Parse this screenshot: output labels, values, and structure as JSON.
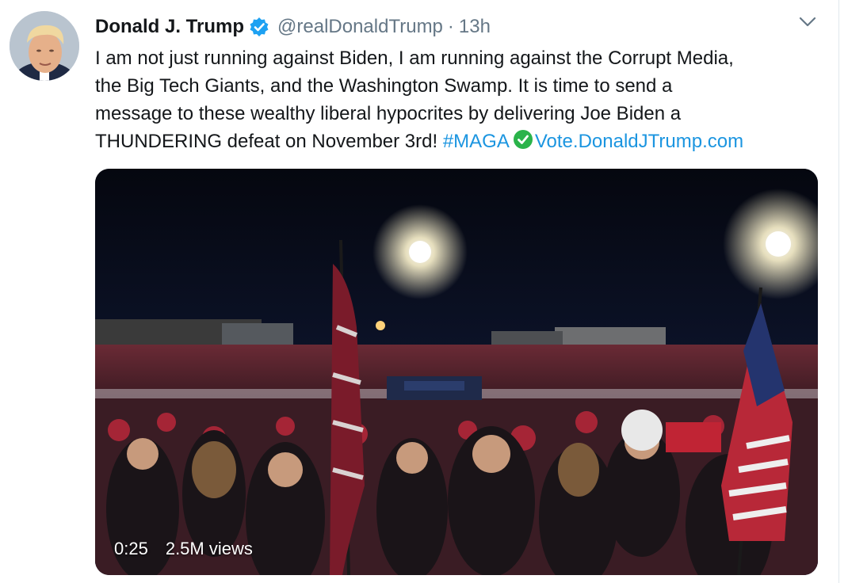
{
  "tweet": {
    "author_name": "Donald J. Trump",
    "handle": "@realDonaldTrump",
    "separator": "·",
    "timestamp": "13h",
    "text_lines": [
      "I am not just running against Biden, I am running against the Corrupt Media,",
      "the Big Tech Giants, and the Washington Swamp. It is time to send a",
      "message to these wealthy liberal hypocrites by delivering Joe Biden a"
    ],
    "last_line_text": "THUNDERING defeat on November 3rd! ",
    "hashtag": "#MAGA",
    "link": "Vote.DonaldJTrump.com"
  },
  "video": {
    "duration": "0:25",
    "views": "2.5M views"
  },
  "icons": {
    "verified": "verified-badge-icon",
    "caret": "chevron-down-icon",
    "emoji": "check-mark-emoji-icon"
  },
  "colors": {
    "link": "#1b95e0",
    "verified": "#1da1f2",
    "secondary_text": "#657786",
    "emoji_green": "#2ab34a"
  }
}
